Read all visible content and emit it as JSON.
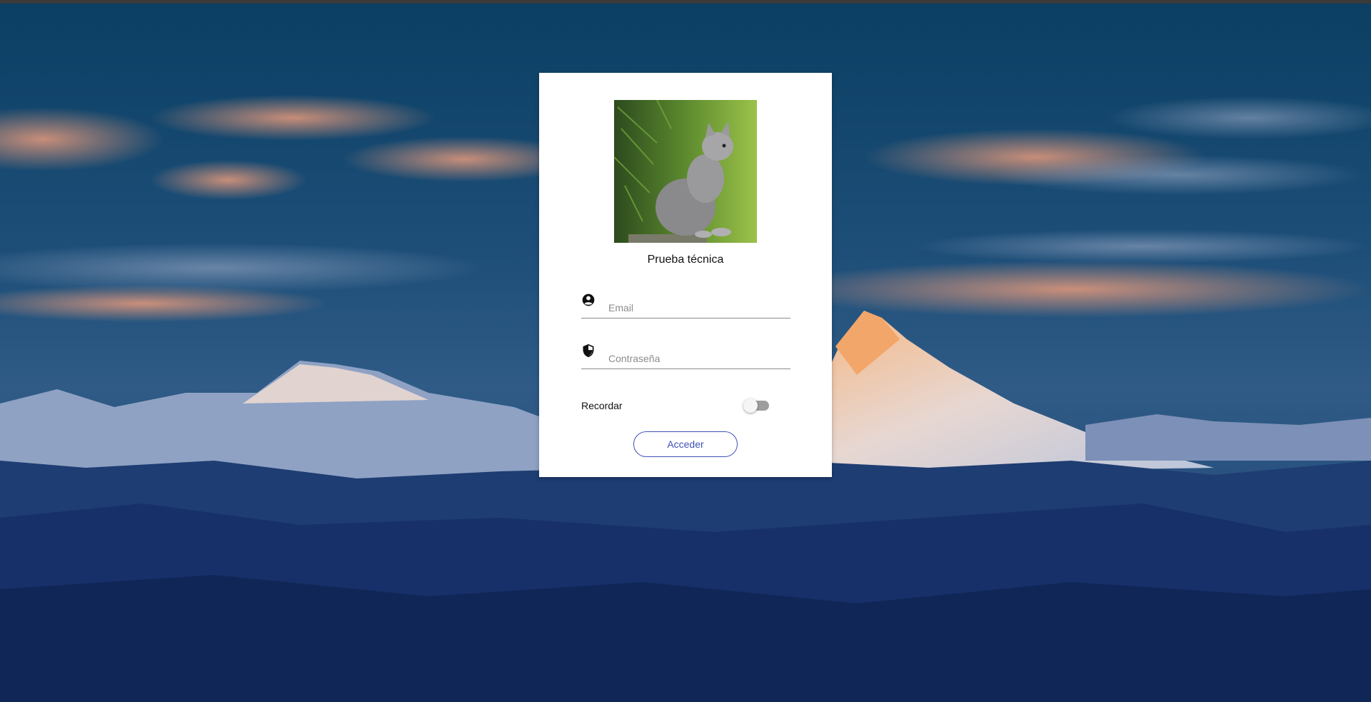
{
  "app": {
    "title": "Prueba técnica"
  },
  "form": {
    "email": {
      "icon": "account-circle-icon",
      "placeholder": "Email",
      "value": ""
    },
    "password": {
      "icon": "shield-icon",
      "placeholder": "Contraseña",
      "value": ""
    },
    "remember": {
      "label": "Recordar",
      "checked": false
    },
    "submit_label": "Acceder"
  },
  "colors": {
    "accent": "#3f51b5",
    "card": "#ffffff",
    "background_sky": "#0f3a66"
  }
}
